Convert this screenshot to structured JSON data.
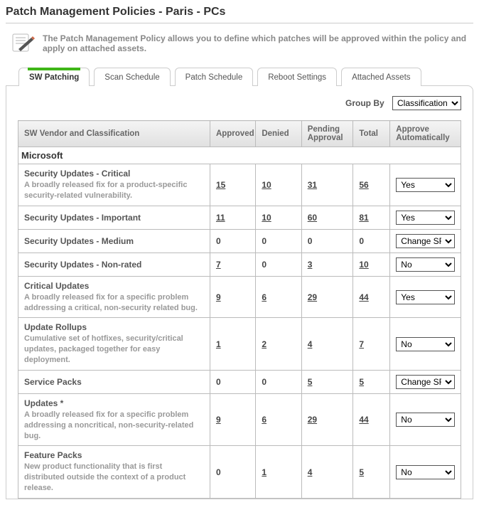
{
  "title": "Patch Management Policies - Paris - PCs",
  "intro_text": "The Patch Management Policy allows you to define which patches will be approved within the policy and apply on attached assets.",
  "tabs": [
    {
      "label": "SW Patching",
      "active": true
    },
    {
      "label": "Scan Schedule",
      "active": false
    },
    {
      "label": "Patch Schedule",
      "active": false
    },
    {
      "label": "Reboot Settings",
      "active": false
    },
    {
      "label": "Attached Assets",
      "active": false
    }
  ],
  "groupby": {
    "label": "Group By",
    "value": "Classification",
    "options": [
      "Classification"
    ]
  },
  "columns": {
    "cat": "SW Vendor and Classification",
    "approved": "Approved",
    "denied": "Denied",
    "pending": "Pending Approval",
    "total": "Total",
    "auto": "Approve Automatically"
  },
  "auto_options": [
    "Yes",
    "No",
    "Change SR"
  ],
  "vendor": "Microsoft",
  "rows": [
    {
      "name": "Security Updates - Critical",
      "desc": "A broadly released fix for a product-specific security-related vulnerability.",
      "approved": "15",
      "denied": "10",
      "pending": "31",
      "total": "56",
      "linked": true,
      "auto": "Yes"
    },
    {
      "name": "Security Updates - Important",
      "desc": "",
      "approved": "11",
      "denied": "10",
      "pending": "60",
      "total": "81",
      "linked": true,
      "auto": "Yes"
    },
    {
      "name": "Security Updates - Medium",
      "desc": "",
      "approved": "0",
      "denied": "0",
      "pending": "0",
      "total": "0",
      "linked": false,
      "auto": "Change SR"
    },
    {
      "name": "Security Updates - Non-rated",
      "desc": "",
      "approved": "7",
      "denied": "0",
      "pending": "3",
      "total": "10",
      "linked": true,
      "auto": "No"
    },
    {
      "name": "Critical Updates",
      "desc": "A broadly released fix for a specific problem addressing a critical, non-security related bug.",
      "approved": "9",
      "denied": "6",
      "pending": "29",
      "total": "44",
      "linked": true,
      "auto": "Yes"
    },
    {
      "name": "Update Rollups",
      "desc": "Cumulative set of hotfixes, security/critical updates, packaged together for easy deployment.",
      "approved": "1",
      "denied": "2",
      "pending": "4",
      "total": "7",
      "linked": true,
      "auto": "No"
    },
    {
      "name": "Service Packs",
      "desc": "",
      "approved": "0",
      "denied": "0",
      "pending": "5",
      "total": "5",
      "linked": true,
      "auto": "Change SR"
    },
    {
      "name": "Updates *",
      "desc": "A broadly released fix for a specific problem addressing a noncritical, non-security-related bug.",
      "approved": "9",
      "denied": "6",
      "pending": "29",
      "total": "44",
      "linked": true,
      "auto": "No"
    },
    {
      "name": "Feature Packs",
      "desc": "New product functionality that is first distributed outside the context of a product release.",
      "approved": "0",
      "denied": "1",
      "pending": "4",
      "total": "5",
      "linked": true,
      "auto": "No"
    }
  ]
}
